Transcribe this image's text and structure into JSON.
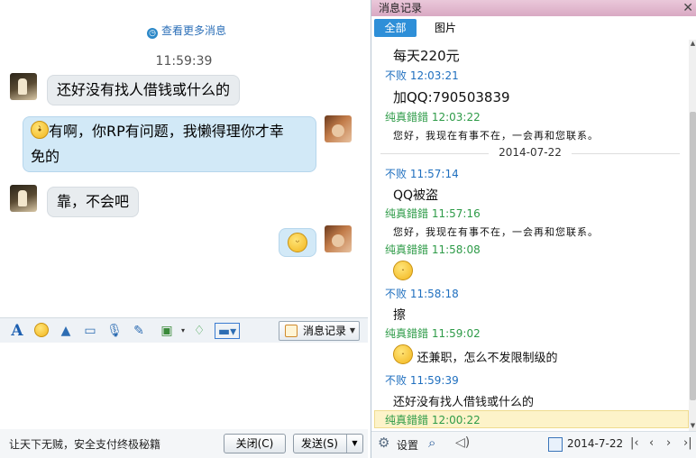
{
  "chat": {
    "more_link": "查看更多消息",
    "timestamp": "11:59:39",
    "messages": [
      {
        "side": "left",
        "text": "还好没有找人借钱或什么的"
      },
      {
        "side": "right",
        "line1": "有啊，你RP有问题，我懒得理你才幸",
        "line2": "免的"
      },
      {
        "side": "left",
        "text": "靠，不会吧"
      },
      {
        "side": "right",
        "emoji": "grin-icon"
      }
    ]
  },
  "toolbar": {
    "icons": [
      "font-icon",
      "emoji-icon",
      "magic-icon",
      "screenshot-icon",
      "voice-icon",
      "note-icon",
      "image-icon",
      "gift-icon",
      "screen-share-icon"
    ],
    "record_label": "消息记录"
  },
  "bottom": {
    "slogan": "让天下无贼，安全支付终极秘籍",
    "close_label": "关闭(C)",
    "send_label": "发送(S)"
  },
  "history": {
    "title": "消息记录",
    "tabs": [
      "全部",
      "图片"
    ],
    "entries": [
      {
        "type": "msg",
        "text": "每天220元"
      },
      {
        "type": "name",
        "color": "blue",
        "text": "不败 12:03:21"
      },
      {
        "type": "msg",
        "text": "加QQ:790503839"
      },
      {
        "type": "name",
        "color": "green",
        "text": "纯真錯錯 12:03:22"
      },
      {
        "type": "auto",
        "text": "您好，我现在有事不在，一会再和您联系。"
      },
      {
        "type": "date",
        "text": "2014-07-22"
      },
      {
        "type": "name",
        "color": "blue",
        "text": "不败 11:57:14"
      },
      {
        "type": "msg",
        "text": "QQ被盗"
      },
      {
        "type": "name",
        "color": "green",
        "text": "纯真錯錯 11:57:16"
      },
      {
        "type": "auto",
        "text": "您好，我现在有事不在，一会再和您联系。"
      },
      {
        "type": "name",
        "color": "green",
        "text": "纯真錯錯 11:58:08"
      },
      {
        "type": "name",
        "color": "blue",
        "text": "不败 11:58:18"
      },
      {
        "type": "msg",
        "text": "擦"
      },
      {
        "type": "name",
        "color": "green",
        "text": "纯真錯錯 11:59:02"
      },
      {
        "type": "msg",
        "text": "还兼职，怎么不发限制级的"
      },
      {
        "type": "name",
        "color": "blue",
        "text": "不败 11:59:39"
      },
      {
        "type": "msg",
        "text": "还好没有找人借钱或什么的"
      },
      {
        "type": "name",
        "color": "green",
        "text": "纯真錯錯 12:00:22"
      }
    ],
    "settings_label": "设置",
    "date_value": "2014-7-22"
  }
}
